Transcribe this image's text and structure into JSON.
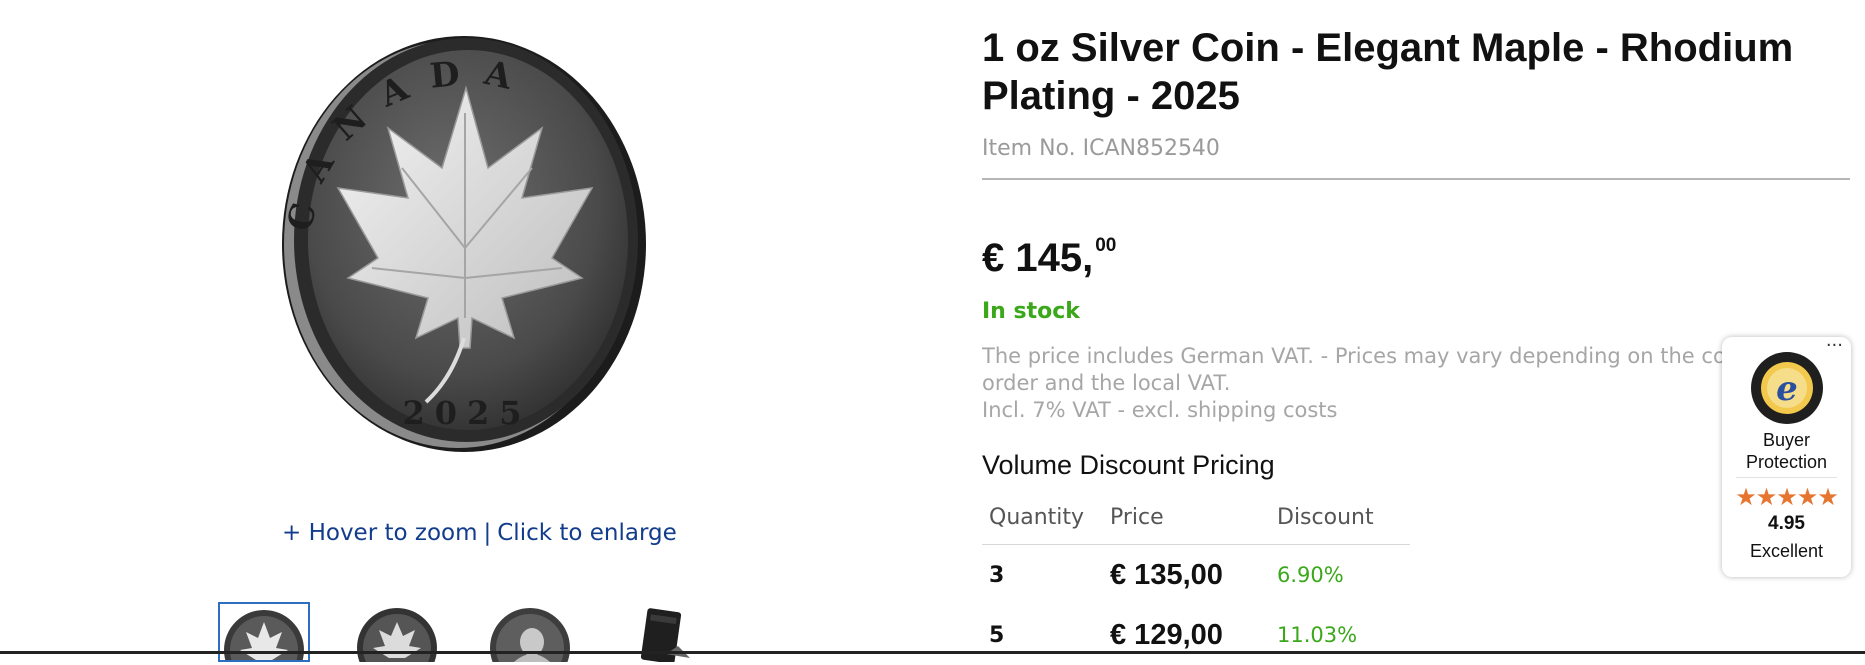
{
  "gallery": {
    "coin_legend": "CANADA",
    "coin_year": "2025",
    "zoom_hint": {
      "hover": "+ Hover to zoom",
      "separator": "|",
      "click": "Click to enlarge"
    },
    "thumbnails": [
      {
        "icon": "coin-reverse-thumb",
        "selected": true
      },
      {
        "icon": "coin-reverse-variant-thumb",
        "selected": false
      },
      {
        "icon": "coin-obverse-thumb",
        "selected": false
      },
      {
        "icon": "coin-case-thumb",
        "selected": false
      }
    ]
  },
  "product": {
    "title": "1 oz Silver Coin - Elegant Maple - Rhodium Plating - 2025",
    "item_number": "Item No. ICAN852540",
    "price_main": "€ 145,",
    "price_cents": "00",
    "availability": "In stock",
    "vat_note_line1": "The price includes German VAT. - Prices may vary depending on the country of",
    "vat_note_line2": "order and the local VAT.",
    "vat_note_line3": "Incl. 7% VAT  -  excl. shipping costs"
  },
  "volume_discount": {
    "title": "Volume Discount Pricing",
    "columns": [
      "Quantity",
      "Price",
      "Discount"
    ],
    "rows": [
      {
        "quantity": "3",
        "price": "€ 135,00",
        "discount": "6.90%"
      },
      {
        "quantity": "5",
        "price": "€ 129,00",
        "discount": "11.03%"
      }
    ]
  },
  "trusted_shops": {
    "more": "···",
    "seal_icon": "trusted-shops-seal-icon",
    "label": "Buyer Protection",
    "stars": "★★★★★",
    "score": "4.95",
    "rating_text": "Excellent"
  },
  "colors": {
    "accent_link": "#123c8c",
    "in_stock": "#3aa81a",
    "star": "#e6752f"
  }
}
